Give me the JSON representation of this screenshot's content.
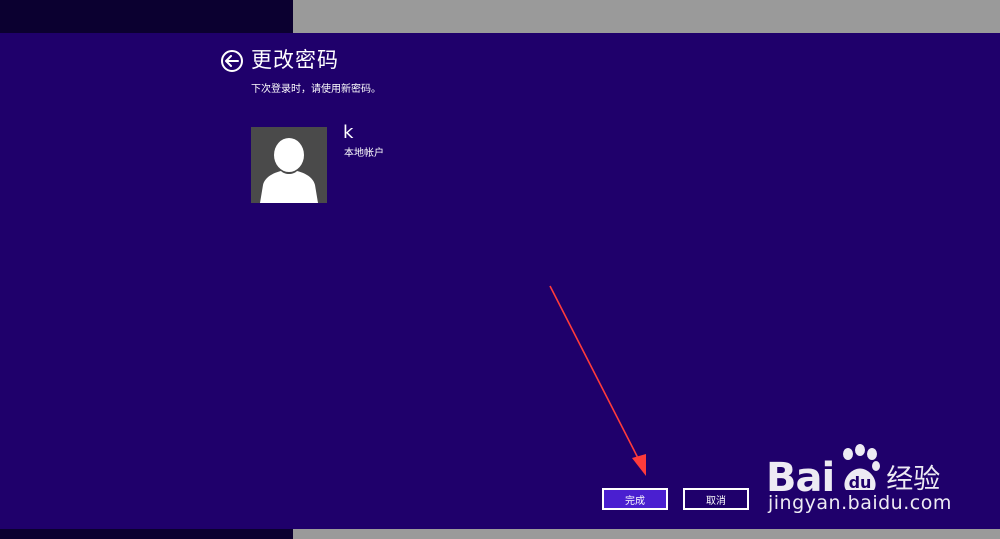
{
  "header": {
    "title": "更改密码",
    "subtitle": "下次登录时，请使用新密码。"
  },
  "account": {
    "name": "k",
    "type": "本地帐户"
  },
  "actions": {
    "finish_label": "完成",
    "cancel_label": "取消"
  },
  "watermark": {
    "brand": "Bai",
    "product": "经验",
    "url": "jingyan.baidu.com"
  },
  "colors": {
    "background": "#1f006b",
    "finish_button": "#4a1fd0",
    "annotation_arrow": "#ff3b3b"
  },
  "icons": {
    "back": "back-arrow-circle-icon",
    "avatar": "user-silhouette-icon",
    "watermark_logo": "baidu-paw-icon"
  }
}
